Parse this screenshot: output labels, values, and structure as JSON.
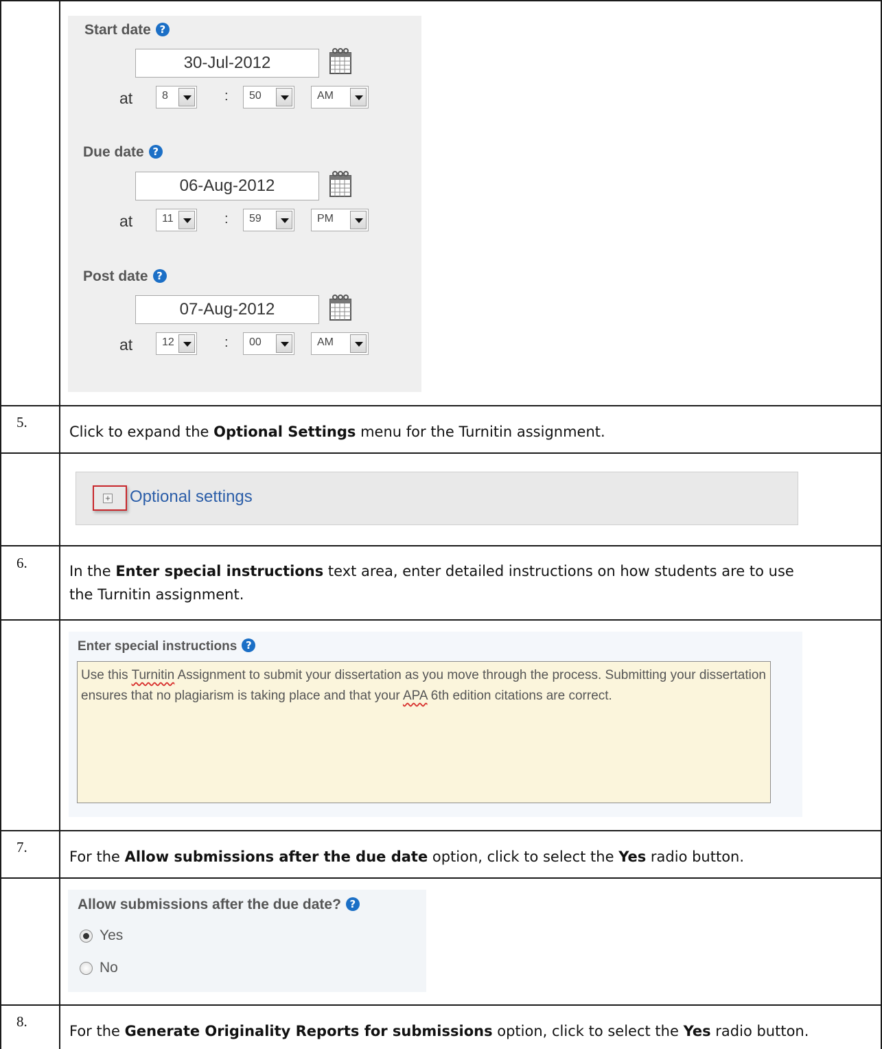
{
  "dates": {
    "start": {
      "label": "Start date",
      "date": "30-Jul-2012",
      "at": "at",
      "hour": "8",
      "minute": "50",
      "ampm": "AM"
    },
    "due": {
      "label": "Due date",
      "date": "06-Aug-2012",
      "at": "at",
      "hour": "11",
      "minute": "59",
      "ampm": "PM"
    },
    "post": {
      "label": "Post date",
      "date": "07-Aug-2012",
      "at": "at",
      "hour": "12",
      "minute": "00",
      "ampm": "AM"
    },
    "colon": ":",
    "help_glyph": "?"
  },
  "steps": [
    {
      "num": "5.",
      "pre": "Click to expand the ",
      "bold1": "Optional Settings",
      "post": " menu for the Turnitin assignment."
    },
    {
      "num": "6.",
      "pre": "In the ",
      "bold1": "Enter special instructions",
      "post": " text area, enter detailed instructions on how students are to use",
      "line2": "the Turnitin assignment."
    },
    {
      "num": "7.",
      "pre": "For the ",
      "bold1": "Allow submissions after the due date",
      "mid": " option, click to select the ",
      "bold2": "Yes",
      "post": " radio button."
    },
    {
      "num": "8.",
      "pre": "For the ",
      "bold1": "Generate Originality Reports for submissions",
      "mid": " option, click to select the ",
      "bold2": "Yes",
      "post": " radio button."
    }
  ],
  "optional": {
    "label": "Optional settings",
    "plus": "+"
  },
  "special": {
    "label": "Enter special instructions",
    "t1": "Use this ",
    "t2": "Turnitin",
    "t3": " Assignment to submit your dissertation as you move through the process. Submitting your dissertation ensures that no plagiarism is taking place and that your ",
    "t4": "APA",
    "t5": " 6th edition citations are correct."
  },
  "allow": {
    "label": "Allow submissions after the due date?",
    "yes": "Yes",
    "no": "No",
    "selected": "Yes"
  }
}
